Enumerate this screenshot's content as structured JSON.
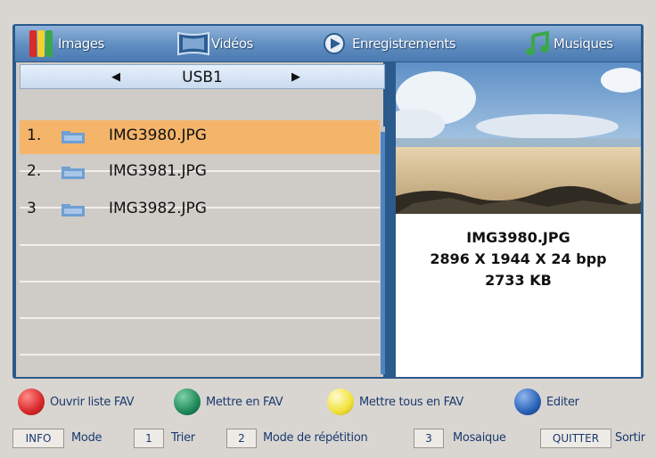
{
  "tabs": [
    {
      "label": "Images",
      "icon": "images-icon"
    },
    {
      "label": "Vidéos",
      "icon": "videos-icon"
    },
    {
      "label": "Enregistrements",
      "icon": "recordings-icon"
    },
    {
      "label": "Musiques",
      "icon": "music-icon"
    }
  ],
  "source": {
    "name": "USB1",
    "prev_icon": "arrow-left-icon",
    "next_icon": "arrow-right-icon"
  },
  "files": [
    {
      "num": "1.",
      "name": "IMG3980.JPG",
      "selected": true
    },
    {
      "num": "2.",
      "name": "IMG3981.JPG",
      "selected": false
    },
    {
      "num": "3",
      "name": "IMG3982.JPG",
      "selected": false
    }
  ],
  "preview": {
    "name": "IMG3980.JPG",
    "dims": "2896 X 1944 X 24 bpp",
    "size": "2733 KB"
  },
  "hints": [
    {
      "color": "#d8282a",
      "label": "Ouvrir liste FAV"
    },
    {
      "color": "#1f8a5a",
      "label": "Mettre en FAV"
    },
    {
      "color": "#f2e23a",
      "label": "Mettre tous en FAV"
    },
    {
      "color": "#2a62b8",
      "label": "Editer"
    }
  ],
  "keys": [
    {
      "key": "INFO",
      "label": "Mode"
    },
    {
      "key": "1",
      "label": "Trier"
    },
    {
      "key": "2",
      "label": "Mode de répétition"
    },
    {
      "key": "3",
      "label": "Mosaique"
    },
    {
      "key": "QUITTER",
      "label": "Sortir"
    }
  ]
}
